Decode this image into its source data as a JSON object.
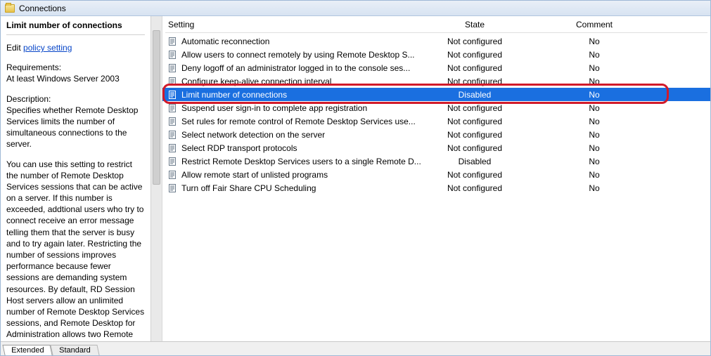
{
  "titlebar": {
    "title": "Connections"
  },
  "left": {
    "heading": "Limit number of connections",
    "edit_prefix": "Edit ",
    "edit_link": "policy setting",
    "requirements_label": "Requirements:",
    "requirements_value": "At least Windows Server 2003",
    "description_label": "Description:",
    "description_body": "Specifies whether Remote Desktop Services limits the number of simultaneous connections to the server.\n\nYou can use this setting to restrict the number of Remote Desktop Services sessions that can be active on a server. If this number is exceeded, addtional users who try to connect receive an error message telling them that the server is busy and to try again later. Restricting the number of sessions improves performance because fewer sessions are demanding system resources. By default, RD Session Host servers allow an unlimited number of Remote Desktop Services sessions, and Remote Desktop for Administration allows two Remote"
  },
  "columns": {
    "setting": "Setting",
    "state": "State",
    "comment": "Comment"
  },
  "rows": [
    {
      "setting": "Automatic reconnection",
      "state": "Not configured",
      "comment": "No",
      "selected": false
    },
    {
      "setting": "Allow users to connect remotely by using Remote Desktop S...",
      "state": "Not configured",
      "comment": "No",
      "selected": false
    },
    {
      "setting": "Deny logoff of an administrator logged in to the console ses...",
      "state": "Not configured",
      "comment": "No",
      "selected": false
    },
    {
      "setting": "Configure keep-alive connection interval",
      "state": "Not configured",
      "comment": "No",
      "selected": false
    },
    {
      "setting": "Limit number of connections",
      "state": "Disabled",
      "comment": "No",
      "selected": true
    },
    {
      "setting": "Suspend user sign-in to complete app registration",
      "state": "Not configured",
      "comment": "No",
      "selected": false
    },
    {
      "setting": "Set rules for remote control of Remote Desktop Services use...",
      "state": "Not configured",
      "comment": "No",
      "selected": false
    },
    {
      "setting": "Select network detection on the server",
      "state": "Not configured",
      "comment": "No",
      "selected": false
    },
    {
      "setting": "Select RDP transport protocols",
      "state": "Not configured",
      "comment": "No",
      "selected": false
    },
    {
      "setting": "Restrict Remote Desktop Services users to a single Remote D...",
      "state": "Disabled",
      "comment": "No",
      "selected": false
    },
    {
      "setting": "Allow remote start of unlisted programs",
      "state": "Not configured",
      "comment": "No",
      "selected": false
    },
    {
      "setting": "Turn off Fair Share CPU Scheduling",
      "state": "Not configured",
      "comment": "No",
      "selected": false
    }
  ],
  "tabs": {
    "extended": "Extended",
    "standard": "Standard"
  }
}
